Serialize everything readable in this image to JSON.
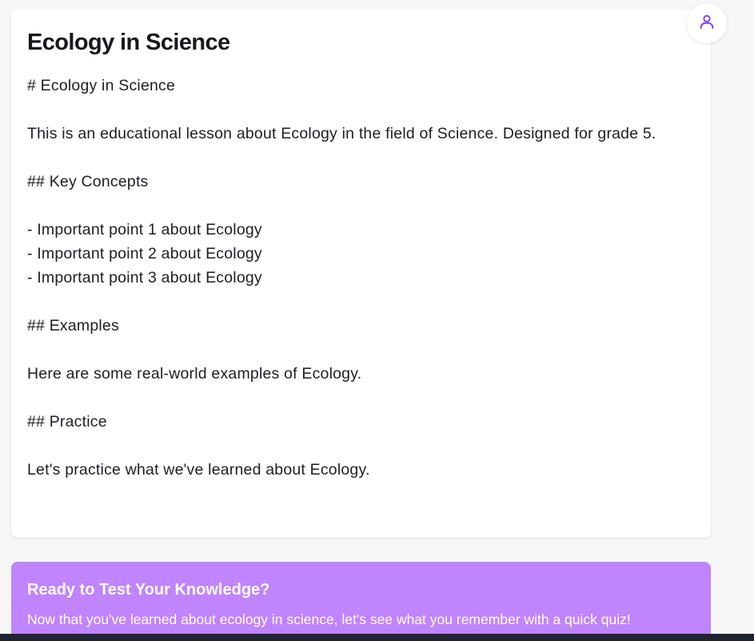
{
  "lesson": {
    "title": "Ecology in Science",
    "lines": [
      "# Ecology in Science",
      "",
      "This is an educational lesson about Ecology in the field of Science. Designed for grade 5.",
      "",
      "## Key Concepts",
      "",
      "- Important point 1 about Ecology",
      "- Important point 2 about Ecology",
      "- Important point 3 about Ecology",
      "",
      "## Examples",
      "",
      "Here are some real-world examples of Ecology.",
      "",
      "## Practice",
      "",
      "Let's practice what we've learned about Ecology."
    ]
  },
  "profile": {
    "icon": "user-icon",
    "accent": "#7c3aed"
  },
  "quiz": {
    "title": "Ready to Test Your Knowledge?",
    "text": "Now that you've learned about ecology in science, let's see what you remember with a quick quiz!",
    "background": "#c084fc"
  }
}
